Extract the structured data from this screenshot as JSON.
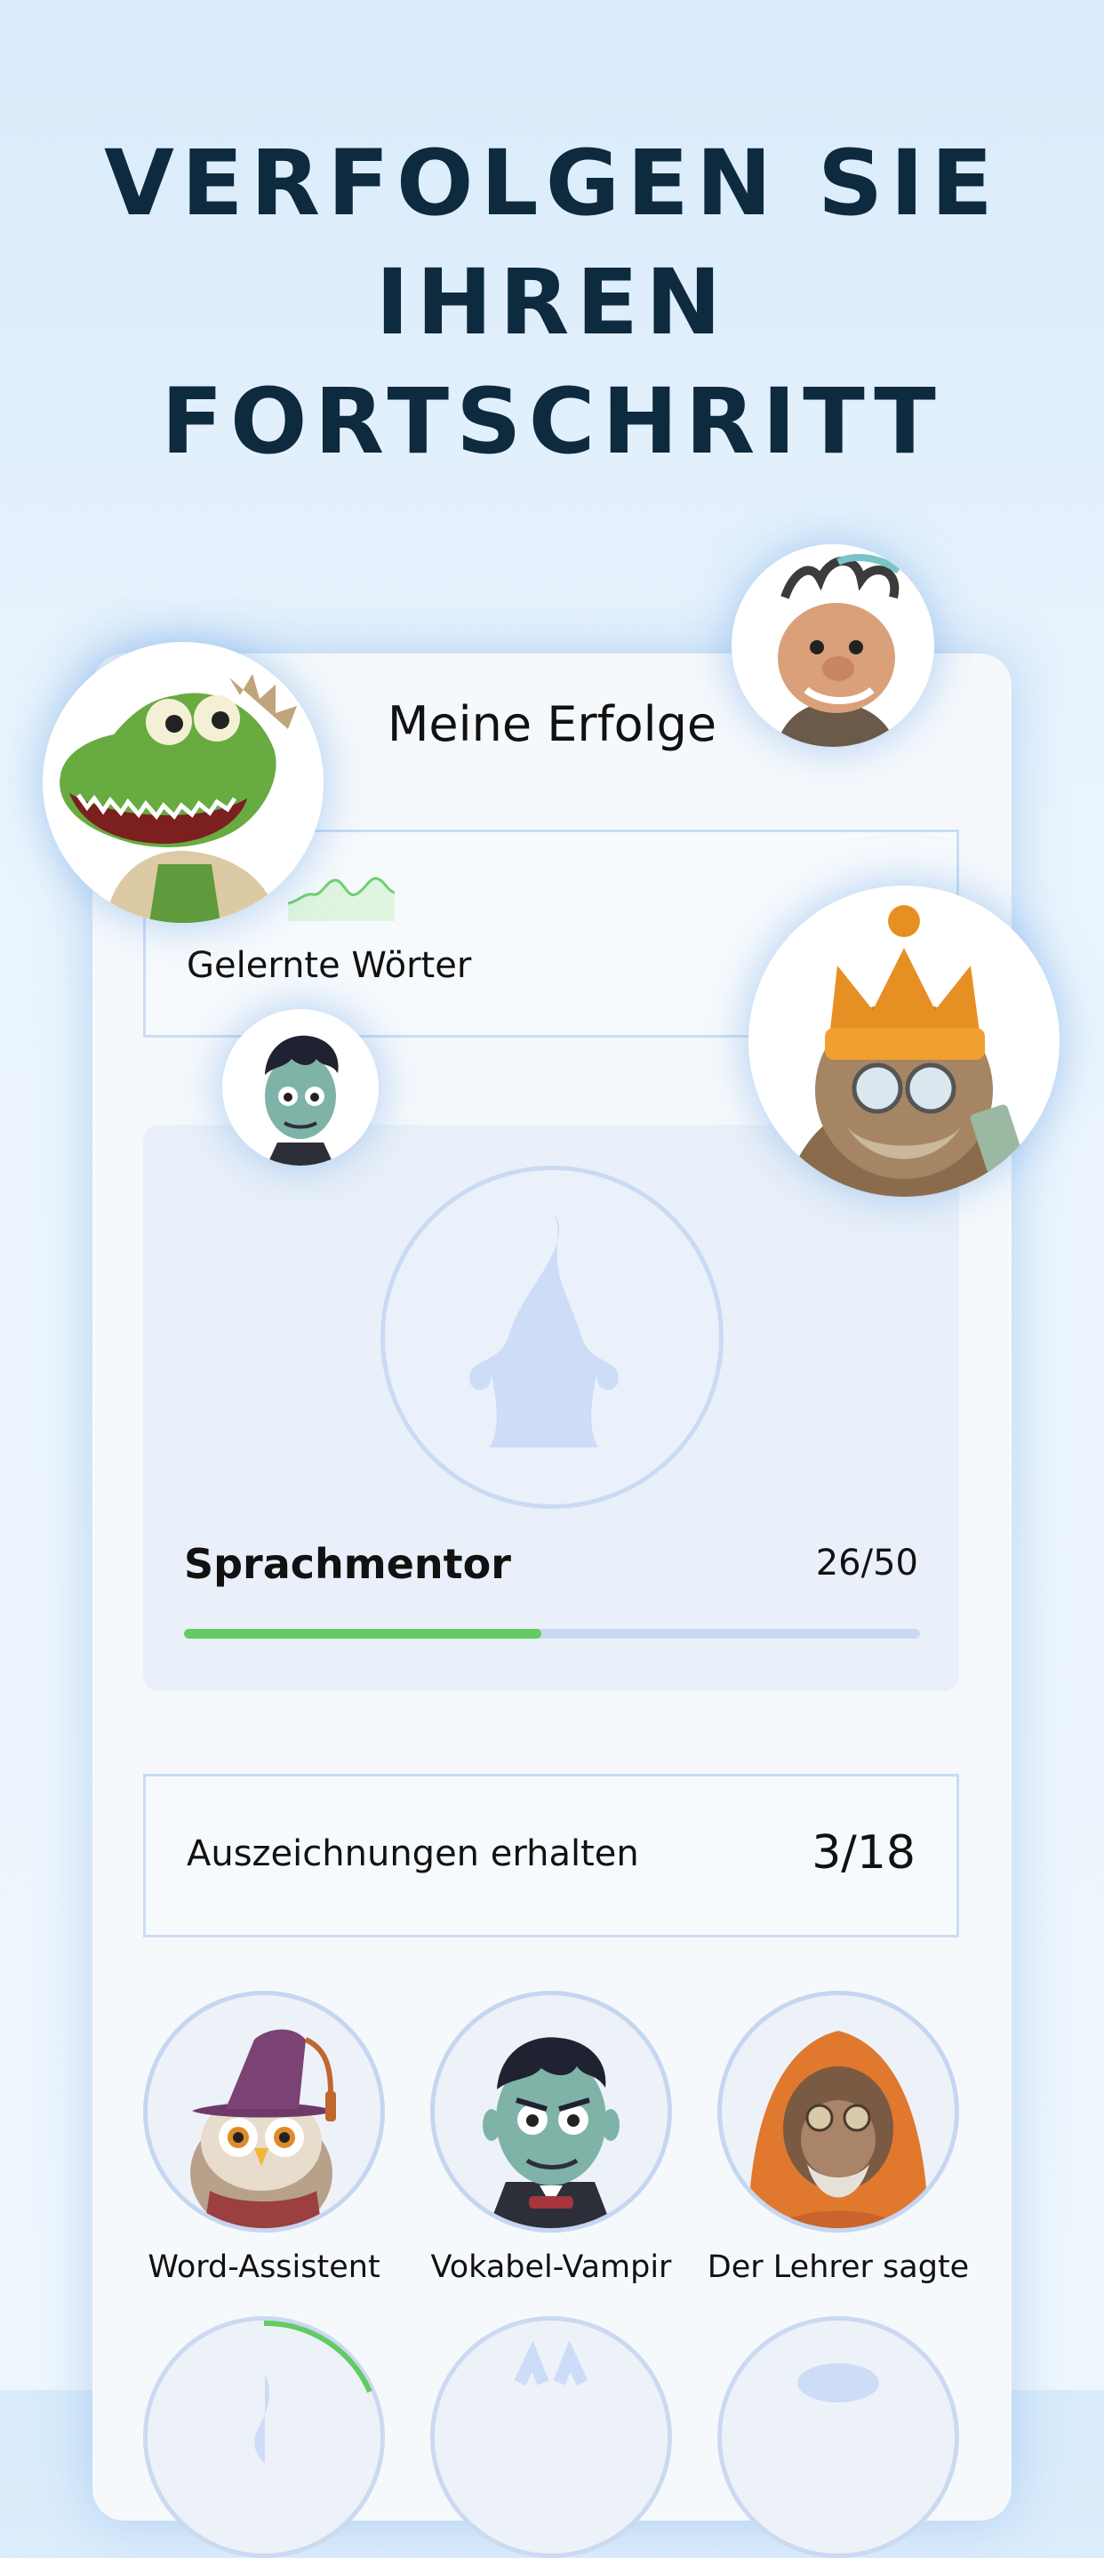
{
  "hero": {
    "title_lines": [
      "VERFOLGEN SIE",
      "IHREN",
      "FORTSCHRITT"
    ]
  },
  "card": {
    "title": "Meine Erfolge",
    "words_label": "Gelernte Wörter",
    "achievement": {
      "name": "Sprachmentor",
      "count": "26/50",
      "progress": 0.485
    },
    "awards": {
      "label": "Auszeichnungen erhalten",
      "count": "3/18"
    },
    "badges": [
      {
        "label": "Word-Assistent",
        "icon": "owl-wizard-icon"
      },
      {
        "label": "Vokabel-Vampir",
        "icon": "vampir-icon"
      },
      {
        "label": "Der Lehrer sagte",
        "icon": "monk-ape-icon"
      }
    ]
  },
  "colors": {
    "accent_green": "#62cc62",
    "title_dark": "#0d2a3e",
    "track_blue": "#c9d8f2"
  }
}
